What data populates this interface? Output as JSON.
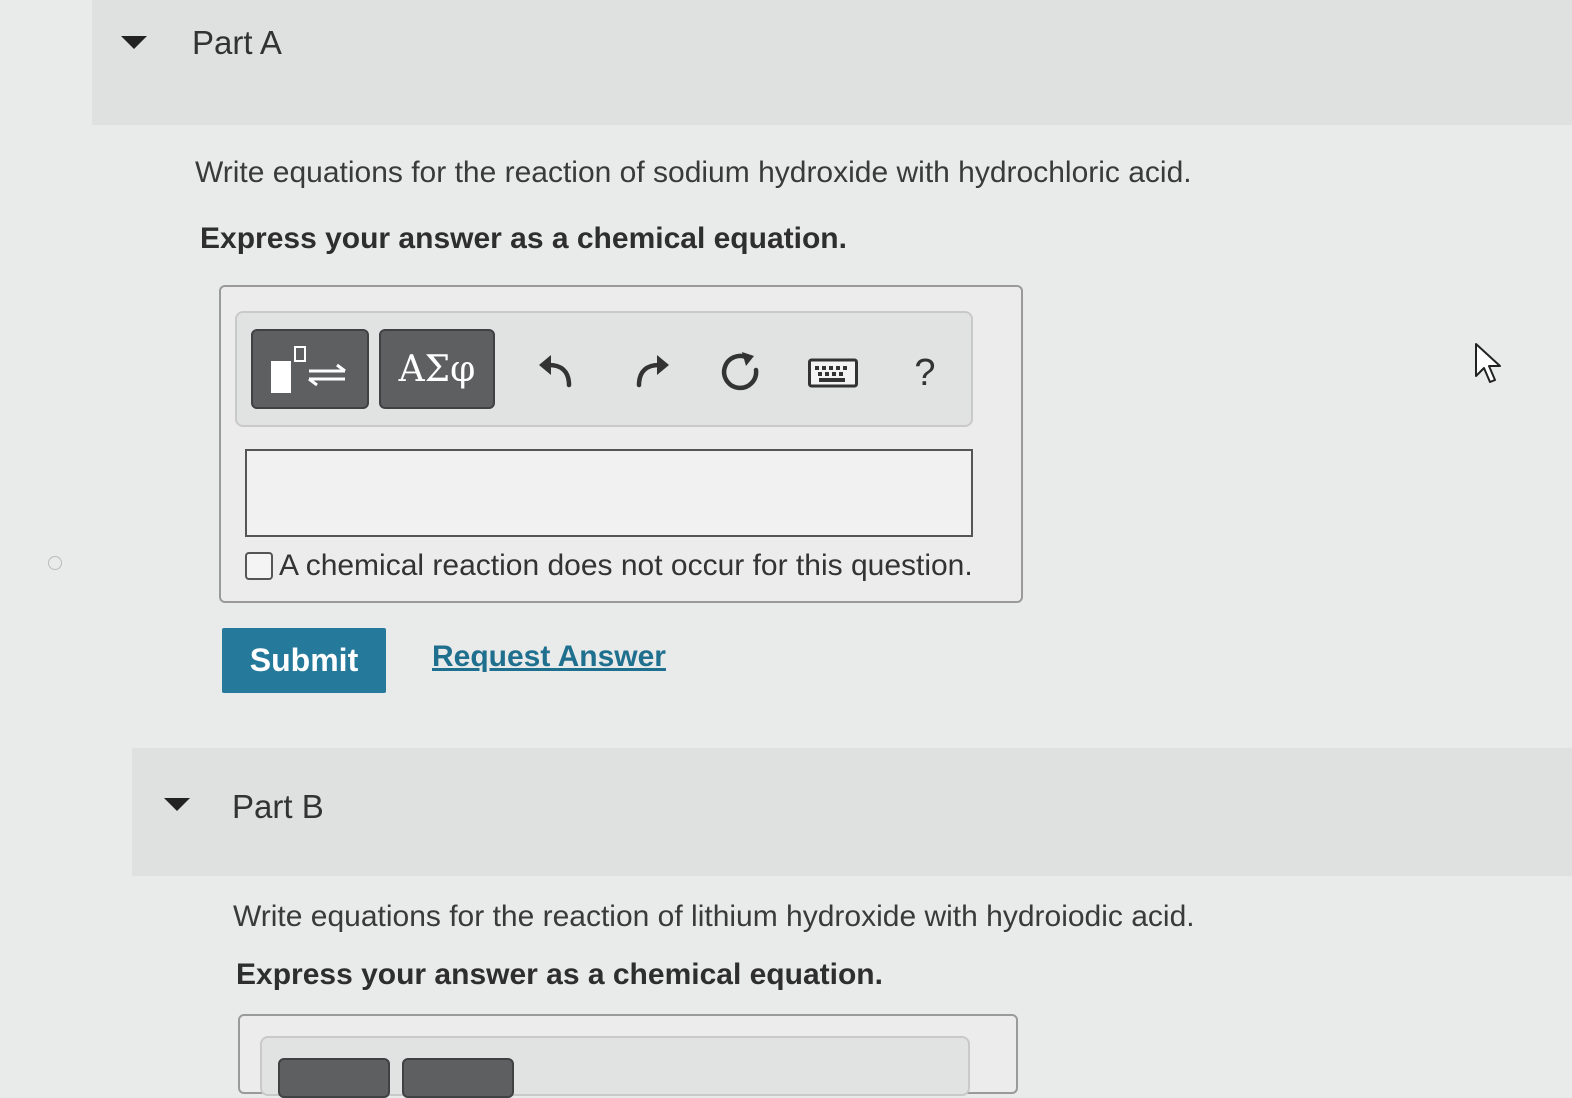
{
  "partA": {
    "title": "Part A",
    "question": "Write equations for the reaction of sodium hydroxide with hydrochloric acid.",
    "instruction": "Express your answer as a chemical equation.",
    "toolbar": {
      "templates_icon": "subscript-superscript-reaction-arrow-icon",
      "symbols_label": "ΑΣφ",
      "undo_icon": "undo-icon",
      "redo_icon": "redo-icon",
      "reset_icon": "reset-icon",
      "keyboard_icon": "keyboard-icon",
      "help_label": "?"
    },
    "answer_value": "",
    "no_reaction_label": "A chemical reaction does not occur for this question.",
    "no_reaction_checked": false,
    "submit_label": "Submit",
    "request_answer_label": "Request Answer"
  },
  "partB": {
    "title": "Part B",
    "question": "Write equations for the reaction of lithium hydroxide with hydroiodic acid.",
    "instruction": "Express your answer as a chemical equation."
  },
  "colors": {
    "submit_bg": "#25799b",
    "link": "#1f6f8f",
    "tool_button": "#5d5f60"
  }
}
